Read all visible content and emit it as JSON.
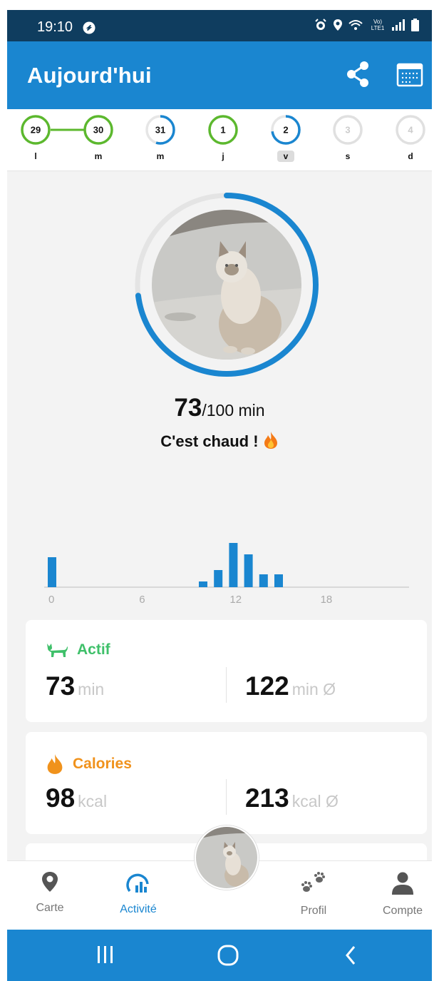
{
  "status_bar": {
    "time": "19:10",
    "network": "Vo) LTE1"
  },
  "header": {
    "title": "Aujourd'hui"
  },
  "days": [
    {
      "number": "29",
      "letter": "l",
      "progress": 1.0,
      "color": "#5cb82e"
    },
    {
      "number": "30",
      "letter": "m",
      "progress": 1.0,
      "color": "#5cb82e"
    },
    {
      "number": "31",
      "letter": "m",
      "progress": 0.55,
      "color": "#1a86d0"
    },
    {
      "number": "1",
      "letter": "j",
      "progress": 1.0,
      "color": "#5cb82e"
    },
    {
      "number": "2",
      "letter": "v",
      "progress": 0.73,
      "color": "#1a86d0",
      "selected": true
    },
    {
      "number": "3",
      "letter": "s",
      "progress": 0,
      "color": "#cccccc"
    },
    {
      "number": "4",
      "letter": "d",
      "progress": 0,
      "color": "#cccccc"
    }
  ],
  "goal": {
    "current": "73",
    "target_text": "/100 min",
    "tagline": "C'est chaud !",
    "progress": 0.73
  },
  "hourly_activity": {
    "x_ticks": [
      "0",
      "6",
      "12",
      "18"
    ],
    "values_by_hour": [
      42,
      0,
      0,
      0,
      0,
      0,
      0,
      0,
      0,
      0,
      8,
      24,
      62,
      46,
      18,
      18,
      0,
      0,
      0,
      0,
      0,
      0,
      0,
      0
    ]
  },
  "cards": {
    "active": {
      "title": "Actif",
      "value": "73",
      "unit": "min",
      "avg_value": "122",
      "avg_unit": "min Ø",
      "color": "#3fc06a"
    },
    "calories": {
      "title": "Calories",
      "value": "98",
      "unit": "kcal",
      "avg_value": "213",
      "avg_unit": "kcal Ø",
      "color": "#f0921c"
    }
  },
  "nav": {
    "map": "Carte",
    "activity": "Activité",
    "profile": "Profil",
    "account": "Compte"
  },
  "colors": {
    "primary": "#1a86d0",
    "status_bar": "#0f3d5f",
    "green": "#5cb82e"
  }
}
